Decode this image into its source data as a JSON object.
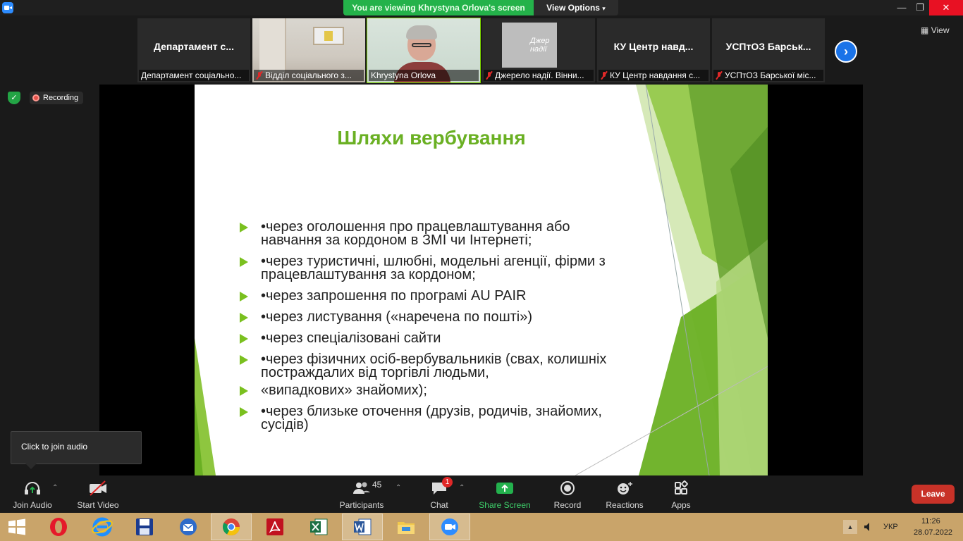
{
  "window": {
    "viewing_banner": "You are viewing Khrystyna Orlova's screen",
    "view_options": "View Options",
    "minimize": "—",
    "maximize": "❐",
    "close": "✕"
  },
  "gallery": {
    "view_label": "View",
    "tiles": [
      {
        "name": "Департамент с...",
        "label": "Департамент соціально...",
        "muted": false,
        "type": "name"
      },
      {
        "name": "",
        "label": "Відділ соціального з...",
        "muted": true,
        "type": "room"
      },
      {
        "name": "",
        "label": "Khrystyna Orlova",
        "muted": false,
        "type": "camera"
      },
      {
        "name": "",
        "label": "Джерело надії. Вінни...",
        "muted": true,
        "type": "logo",
        "logo_text": "Джер надії"
      },
      {
        "name": "КУ Центр навд...",
        "label": "КУ Центр навдання с...",
        "muted": true,
        "type": "name"
      },
      {
        "name": "УСПтОЗ Барськ...",
        "label": "УСПтОЗ Барської міс...",
        "muted": true,
        "type": "name"
      }
    ]
  },
  "status": {
    "recording": "Recording"
  },
  "slide": {
    "title": "Шляхи вербування",
    "bullets": [
      {
        "text": "•через оголошення про працевлаштування або навчання за кордоном в ЗМІ чи Інтернеті;"
      },
      {
        "text": "•через туристичні, шлюбні, модельні агенції, фірми з працевлаштування за кордоном;"
      },
      {
        "text": "•через запрошення по програмі AU PAIR"
      },
      {
        "text": "•через листування («наречена по пошті»)"
      },
      {
        "text": "•через спеціалізовані сайти"
      },
      {
        "text": "•через фізичних осіб-вербувальників (свах, колишніх постраждалих від торгівлі людьми,"
      },
      {
        "text": "«випадкових» знайомих);"
      },
      {
        "text": "•через близьке оточення (друзів, родичів, знайомих, сусідів)"
      }
    ]
  },
  "tooltip": {
    "text": "Click to join audio"
  },
  "controls": {
    "join_audio": "Join Audio",
    "start_video": "Start Video",
    "participants": "Participants",
    "participants_count": "45",
    "chat": "Chat",
    "chat_badge": "1",
    "share_screen": "Share Screen",
    "record": "Record",
    "reactions": "Reactions",
    "apps": "Apps",
    "leave": "Leave"
  },
  "taskbar": {
    "icons": [
      "windows-start",
      "opera",
      "internet-explorer",
      "save-disk",
      "thunderbird",
      "chrome",
      "adobe-acrobat",
      "excel",
      "word",
      "file-explorer",
      "zoom"
    ],
    "language": "УКР",
    "time": "11:26",
    "date": "28.07.2022"
  },
  "colors": {
    "banner_green": "#24b24a",
    "slide_accent": "#6ab023",
    "leave_red": "#c83228",
    "share_green": "#23b14d",
    "taskbar": "#c9a46a"
  }
}
